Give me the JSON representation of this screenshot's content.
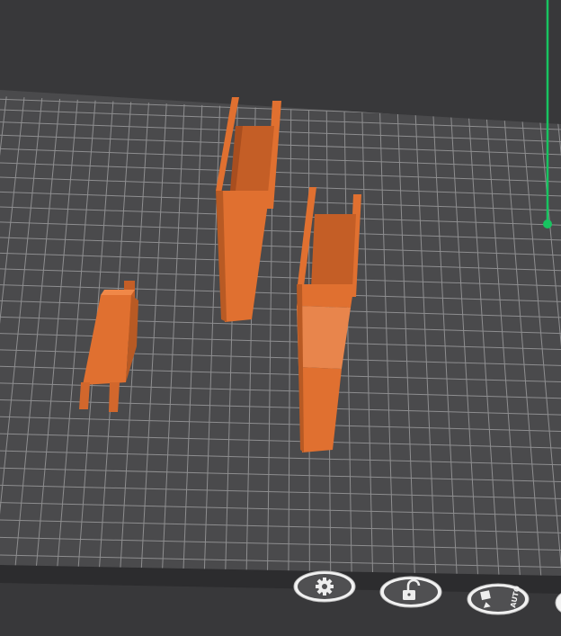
{
  "scene": {
    "background_color": "#38383a",
    "bed_color": "#4a4a4c",
    "bed_edge_color": "#2c2c2e",
    "grid_color": "#9a9a9c",
    "model_color": "#e07030",
    "model_shadow_color": "#b85a24",
    "model_highlight_color": "#f08848",
    "selection_color": "#e8854c",
    "axis_color": "#17c460"
  },
  "toolbar": {
    "settings": {
      "icon": "gear-icon"
    },
    "lock": {
      "icon": "lock-icon"
    },
    "auto_arrange": {
      "icon": "arrange-icon",
      "label": "AUTO"
    }
  }
}
